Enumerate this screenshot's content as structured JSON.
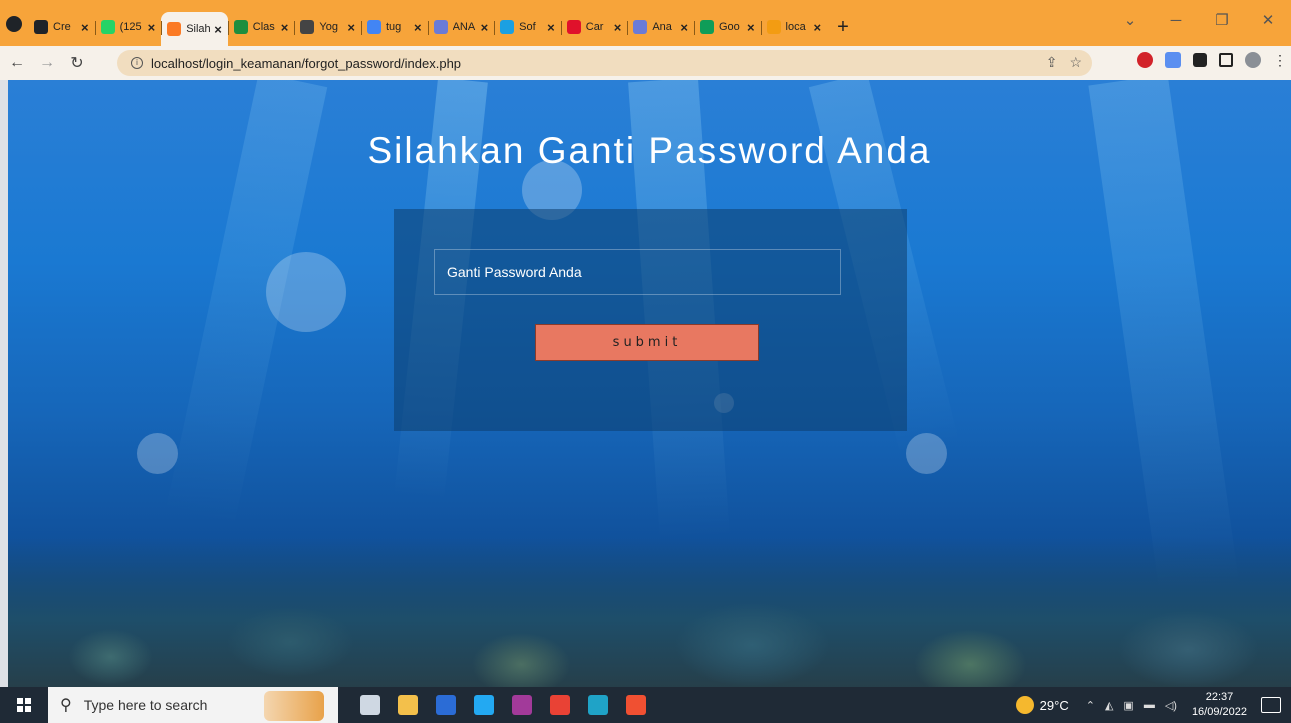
{
  "browser": {
    "tabs": [
      {
        "title": "Cre",
        "icon": "github-icon",
        "color": "#1f2328"
      },
      {
        "title": "(125",
        "icon": "chat-icon",
        "color": "#25d366"
      },
      {
        "title": "Silah",
        "icon": "xampp-icon",
        "color": "#fb7a24",
        "active": true
      },
      {
        "title": "Clas",
        "icon": "classroom-icon",
        "color": "#1e8e3e"
      },
      {
        "title": "Yog",
        "icon": "globe-icon",
        "color": "#444444"
      },
      {
        "title": "tug",
        "icon": "google-icon",
        "color": "#4285f4"
      },
      {
        "title": "ANA",
        "icon": "analytics-icon",
        "color": "#6b7bd6"
      },
      {
        "title": "Sof",
        "icon": "software-icon",
        "color": "#1ba0e2"
      },
      {
        "title": "Car",
        "icon": "opera-icon",
        "color": "#e0112b"
      },
      {
        "title": "Ana",
        "icon": "analytics-icon",
        "color": "#6b7bd6"
      },
      {
        "title": "Goo",
        "icon": "sheets-icon",
        "color": "#0f9d58"
      },
      {
        "title": "loca",
        "icon": "phpmyadmin-icon",
        "color": "#f39c12"
      }
    ],
    "new_tab": "+",
    "address": "localhost/login_keamanan/forgot_password/index.php"
  },
  "page": {
    "title": "Silahkan Ganti Password Anda",
    "input_placeholder": "Ganti Password Anda",
    "submit_label": "submit"
  },
  "taskbar": {
    "search_placeholder": "Type here to search",
    "temperature": "29°C",
    "time": "22:37",
    "date": "16/09/2022",
    "apps": [
      {
        "icon": "task-view-icon",
        "color": "#cfd8e3"
      },
      {
        "icon": "file-explorer-icon",
        "color": "#f3c04b"
      },
      {
        "icon": "word-icon",
        "color": "#2b6cd6"
      },
      {
        "icon": "vscode-icon",
        "color": "#23a9f2"
      },
      {
        "icon": "winrar-icon",
        "color": "#a23a9a"
      },
      {
        "icon": "chrome-icon",
        "color": "#e94235"
      },
      {
        "icon": "edge-icon",
        "color": "#1fa3c7"
      },
      {
        "icon": "git-icon",
        "color": "#f05032"
      }
    ]
  }
}
